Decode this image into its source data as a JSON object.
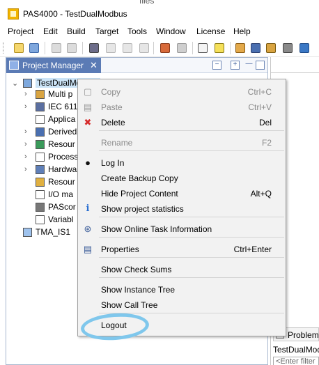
{
  "window": {
    "title": "PAS4000 - TestDualModbus",
    "background_tab_fragment": "files"
  },
  "menubar": {
    "items": [
      "Project",
      "Edit",
      "Build",
      "Target",
      "Tools",
      "Window",
      "License",
      "Help"
    ]
  },
  "project_manager": {
    "tab_label": "Project Manager",
    "tree": [
      {
        "label": "TestDualModbus",
        "expander": "⌄",
        "icon": "project-icon",
        "selected": true
      },
      {
        "label": "Multi p",
        "expander": "›",
        "icon": "modules-icon"
      },
      {
        "label": "IEC 611",
        "expander": "›",
        "icon": "iec-icon"
      },
      {
        "label": "Applica",
        "expander": "",
        "icon": "application-icon"
      },
      {
        "label": "Derived",
        "expander": "›",
        "icon": "derived-icon"
      },
      {
        "label": "Resour",
        "expander": "›",
        "icon": "resource-globe-icon"
      },
      {
        "label": "Process",
        "expander": "›",
        "icon": "process-icon"
      },
      {
        "label": "Hardwa",
        "expander": "›",
        "icon": "hardware-icon"
      },
      {
        "label": "Resour",
        "expander": "",
        "icon": "resource-list-icon"
      },
      {
        "label": "I/O ma",
        "expander": "",
        "icon": "io-mapping-icon"
      },
      {
        "label": "PAScor",
        "expander": "",
        "icon": "network-icon"
      },
      {
        "label": "Variabl",
        "expander": "",
        "icon": "variables-icon"
      },
      {
        "label": "TMA_IS1",
        "expander": "",
        "icon": "folder-icon"
      }
    ]
  },
  "right_pane": {
    "problems_tab": "Problem",
    "project_text": "TestDualModbu",
    "filter_placeholder": "<Enter filter"
  },
  "context_menu": {
    "groups": [
      [
        {
          "label": "Copy",
          "shortcut": "Ctrl+C",
          "enabled": false,
          "icon": "copy-icon"
        },
        {
          "label": "Paste",
          "shortcut": "Ctrl+V",
          "enabled": false,
          "icon": "paste-icon"
        },
        {
          "label": "Delete",
          "shortcut": "Del",
          "enabled": true,
          "icon": "delete-x-icon"
        }
      ],
      [
        {
          "label": "Rename",
          "shortcut": "F2",
          "enabled": false,
          "icon": ""
        }
      ],
      [
        {
          "label": "Log In",
          "shortcut": "",
          "enabled": true,
          "icon": "user-icon"
        },
        {
          "label": "Create Backup Copy",
          "shortcut": "",
          "enabled": true,
          "icon": ""
        },
        {
          "label": "Hide Project Content",
          "shortcut": "Alt+Q",
          "enabled": true,
          "icon": ""
        },
        {
          "label": "Show project statistics",
          "shortcut": "",
          "enabled": true,
          "icon": "info-icon"
        }
      ],
      [
        {
          "label": "Show Online Task Information",
          "shortcut": "",
          "enabled": true,
          "icon": "online-task-icon"
        }
      ],
      [
        {
          "label": "Properties",
          "shortcut": "Ctrl+Enter",
          "enabled": true,
          "icon": "properties-icon"
        }
      ],
      [
        {
          "label": "Show Check Sums",
          "shortcut": "",
          "enabled": true,
          "icon": ""
        }
      ],
      [
        {
          "label": "Show Instance Tree",
          "shortcut": "",
          "enabled": true,
          "icon": ""
        },
        {
          "label": "Show Call Tree",
          "shortcut": "",
          "enabled": true,
          "icon": ""
        }
      ],
      [
        {
          "label": "Logout",
          "shortcut": "",
          "enabled": true,
          "icon": "",
          "annotated": true
        }
      ]
    ]
  },
  "colors": {
    "pane_tab": "#5b7bb5",
    "menu_background": "#f2f2f2",
    "annotation_highlight": "#7fc7ec",
    "delete_red": "#d62a2a",
    "info_blue": "#2a6fd1"
  }
}
